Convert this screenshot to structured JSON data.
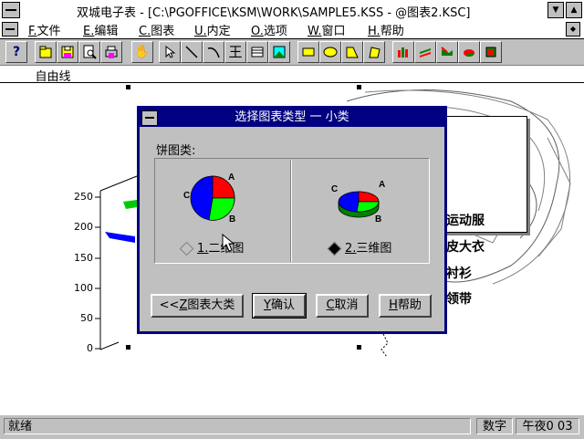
{
  "window": {
    "title": "双城电子表 - [C:\\PGOFFICE\\KSM\\WORK\\SAMPLE5.KSS - @图表2.KSC]"
  },
  "menu": {
    "items": [
      {
        "key": "F.",
        "label": "文件"
      },
      {
        "key": "E.",
        "label": "编辑"
      },
      {
        "key": "C.",
        "label": "图表"
      },
      {
        "key": "U.",
        "label": "内定"
      },
      {
        "key": "O.",
        "label": "选项"
      },
      {
        "key": "W.",
        "label": "窗口"
      },
      {
        "key": "H.",
        "label": "帮助"
      }
    ]
  },
  "toolbar": {
    "tools": [
      "help-icon",
      "open-icon",
      "save-icon",
      "preview-icon",
      "print-icon",
      "hand-icon",
      "pointer-icon",
      "line-icon",
      "arc-icon",
      "text-icon",
      "table-icon",
      "image-icon",
      "rect-icon",
      "ellipse-icon",
      "polygon-icon",
      "freeform-icon",
      "chart-bar-icon",
      "chart-layer-icon",
      "chart-arrow-icon",
      "chart-pie-icon",
      "chart-3d-icon"
    ],
    "text_tool_glyph": "王"
  },
  "tool_status": "自由线",
  "chart": {
    "y_ticks": [
      "250",
      "200",
      "150",
      "100",
      "50",
      "0"
    ],
    "legend": [
      "运动服",
      "皮大衣",
      "衬衫",
      "领带"
    ]
  },
  "dialog": {
    "title": "选择图表类型 一 小类",
    "group_label": "饼图类:",
    "pie_labels": [
      "A",
      "B",
      "C"
    ],
    "options": [
      {
        "key": "1.",
        "label": "二维图",
        "selected": false
      },
      {
        "key": "2.",
        "label": "三维图",
        "selected": true
      }
    ],
    "buttons": {
      "back": {
        "prefix": "<<",
        "key": "Z",
        "label": "图表大类"
      },
      "ok": {
        "key": "Y",
        "label": "确认"
      },
      "cancel": {
        "key": "C",
        "label": "取消"
      },
      "help": {
        "key": "H",
        "label": "帮助"
      }
    }
  },
  "statusbar": {
    "left": "就绪",
    "mode": "数字",
    "time": "午夜0 03"
  }
}
